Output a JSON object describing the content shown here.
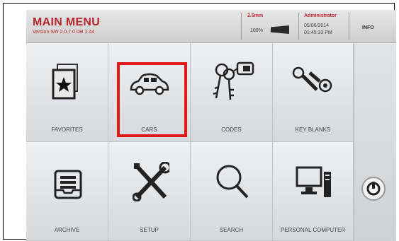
{
  "header": {
    "title": "MAIN MENU",
    "version": "Version SW 2.0.7.0 DB 1.44",
    "cut_size": "2.5mm",
    "battery_percent": "100%",
    "user": "Administrator",
    "date": "05/06/2014",
    "time": "01:45:33 PM",
    "info_label": "INFO"
  },
  "tiles": [
    {
      "label": "FAVORITES",
      "icon": "favorites-star-card-icon"
    },
    {
      "label": "CARS",
      "icon": "car-icon"
    },
    {
      "label": "CODES",
      "icon": "keys-with-tag-icon"
    },
    {
      "label": "KEY BLANKS",
      "icon": "key-blanks-icon"
    },
    {
      "label": "ARCHIVE",
      "icon": "archive-tray-icon"
    },
    {
      "label": "SETUP",
      "icon": "wrench-screwdriver-icon"
    },
    {
      "label": "SEARCH",
      "icon": "magnifier-icon"
    },
    {
      "label": "PERSONAL COMPUTER",
      "icon": "computer-icon"
    }
  ],
  "colors": {
    "accent": "#b3262c",
    "highlight": "#e01818"
  }
}
